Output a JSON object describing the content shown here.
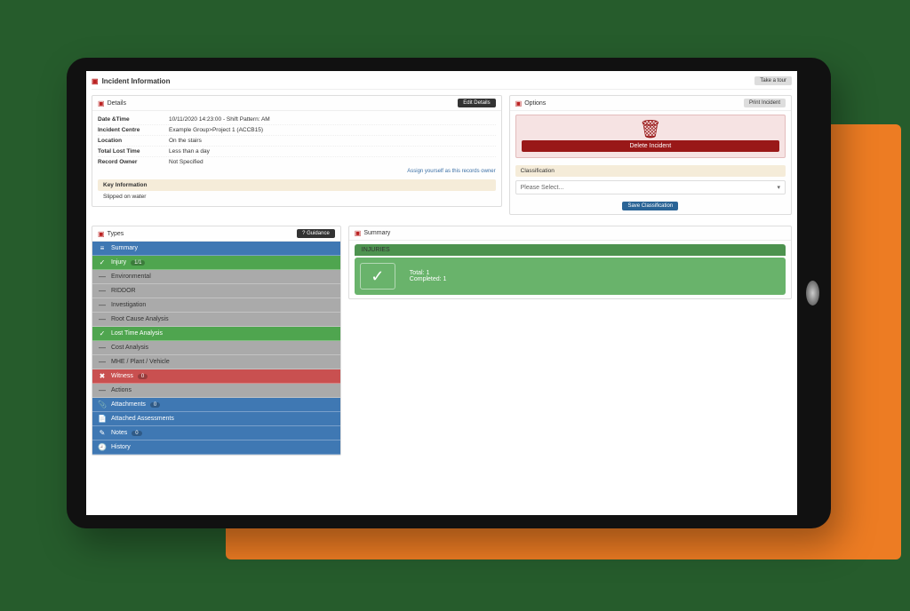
{
  "page": {
    "title": "Incident Information",
    "tour_button": "Take a tour"
  },
  "details": {
    "panel_title": "Details",
    "edit_button": "Edit Details",
    "rows": [
      {
        "k": "Date &Time",
        "v": "10/11/2020 14:23:00 - Shift Pattern: AM"
      },
      {
        "k": "Incident Centre",
        "v": "Example Group>Project 1 (ACCB15)"
      },
      {
        "k": "Location",
        "v": "On the stairs"
      },
      {
        "k": "Total Lost Time",
        "v": "Less than a day"
      },
      {
        "k": "Record Owner",
        "v": "Not Specified"
      }
    ],
    "assign_link": "Assign yourself as this records owner",
    "key_info_label": "Key Information",
    "key_info_text": "Slipped on water"
  },
  "options": {
    "panel_title": "Options",
    "print_button": "Print Incident",
    "delete_label": "Delete Incident",
    "classification_label": "Classification",
    "classification_placeholder": "Please Select...",
    "save_button": "Save Classification"
  },
  "types": {
    "panel_title": "Types",
    "guidance_button": "? Guidance",
    "items": [
      {
        "label": "Summary",
        "style": "it-blue",
        "icon": "≡"
      },
      {
        "label": "Injury",
        "style": "it-green",
        "icon": "✓",
        "badge": "1/1"
      },
      {
        "label": "Environmental",
        "style": "it-gray",
        "icon": "—"
      },
      {
        "label": "RIDDOR",
        "style": "it-gray",
        "icon": "—"
      },
      {
        "label": "Investigation",
        "style": "it-gray",
        "icon": "—"
      },
      {
        "label": "Root Cause Analysis",
        "style": "it-gray",
        "icon": "—"
      },
      {
        "label": "Lost Time Analysis",
        "style": "it-green",
        "icon": "✓"
      },
      {
        "label": "Cost Analysis",
        "style": "it-gray",
        "icon": "—"
      },
      {
        "label": "MHE / Plant / Vehicle",
        "style": "it-gray",
        "icon": "—"
      },
      {
        "label": "Witness",
        "style": "it-red",
        "icon": "✖",
        "badge": "0"
      },
      {
        "label": "Actions",
        "style": "it-gray",
        "icon": "—"
      },
      {
        "label": "Attachments",
        "style": "it-blue",
        "icon": "📎",
        "badge": "0"
      },
      {
        "label": "Attached Assessments",
        "style": "it-blue",
        "icon": "📄"
      },
      {
        "label": "Notes",
        "style": "it-blue",
        "icon": "✎",
        "badge": "0"
      },
      {
        "label": "History",
        "style": "it-blue",
        "icon": "🕘"
      }
    ]
  },
  "summary": {
    "panel_title": "Summary",
    "card_title": "INJURIES",
    "total_label": "Total:",
    "total_value": "1",
    "completed_label": "Completed:",
    "completed_value": "1"
  }
}
